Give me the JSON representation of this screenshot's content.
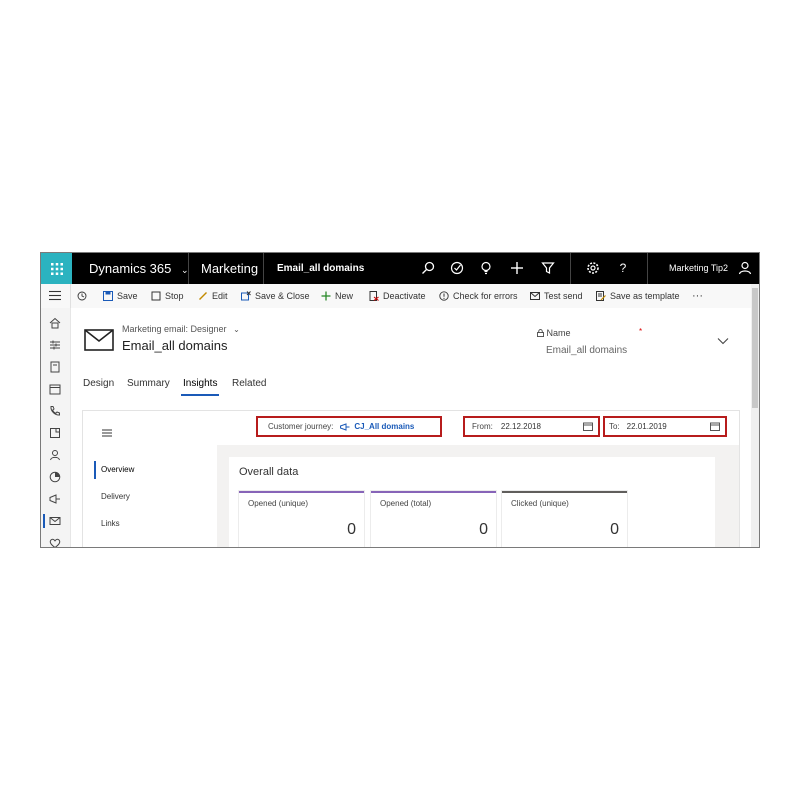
{
  "topnav": {
    "brand": "Dynamics 365",
    "app": "Marketing",
    "record": "Email_all domains",
    "user": "Marketing Tip2"
  },
  "toolbar": {
    "save": "Save",
    "stop": "Stop",
    "edit": "Edit",
    "save_close": "Save & Close",
    "new": "New",
    "deactivate": "Deactivate",
    "check_errors": "Check for errors",
    "test_send": "Test send",
    "save_template": "Save as template",
    "more": "···"
  },
  "header": {
    "form_label": "Marketing email: Designer",
    "title": "Email_all domains",
    "name_label": "Name",
    "name_required": "*",
    "name_value": "Email_all domains"
  },
  "tabs": [
    "Design",
    "Summary",
    "Insights",
    "Related"
  ],
  "filters": {
    "journey_label": "Customer journey:",
    "journey_value": "CJ_All domains",
    "from_label": "From:",
    "from_value": "22.12.2018",
    "to_label": "To:",
    "to_value": "22.01.2019"
  },
  "sidenav": [
    "Overview",
    "Delivery",
    "Links"
  ],
  "overall": {
    "title": "Overall data",
    "tiles": [
      {
        "label": "Opened (unique)",
        "value": "0",
        "color": "#8764b8"
      },
      {
        "label": "Opened (total)",
        "value": "0",
        "color": "#8764b8"
      },
      {
        "label": "Clicked (unique)",
        "value": "0",
        "color": "#605e5c"
      }
    ]
  },
  "colors": {
    "accent": "#1a5ab8",
    "waffle": "#2bb3c0",
    "highlight": "#b71c1c"
  }
}
